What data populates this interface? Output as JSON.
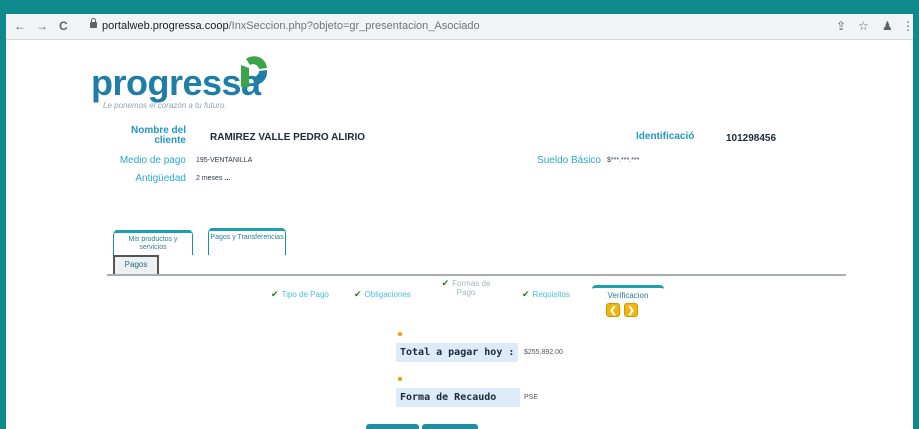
{
  "browser": {
    "url_host": "portalweb.progressa.coop",
    "url_path": "/InxSeccion.php?objeto=gr_presentacion_Asociado",
    "back_glyph": "←",
    "forward_glyph": "→",
    "reload_glyph": "C",
    "share_glyph": "⇪",
    "star_glyph": "☆",
    "profile_glyph": "♟",
    "menu_glyph": "⋮"
  },
  "brand": {
    "name": "progressa",
    "tagline": "Le ponemos el corazón a tu futuro.",
    "colors": {
      "primary": "#1f7ea8",
      "green": "#3aa647",
      "accent": "#1d9fb0"
    }
  },
  "client": {
    "name_label": "Nombre del cliente",
    "name_value": "RAMIREZ VALLE PEDRO ALIRIO",
    "id_label": "Identificació",
    "id_value": "101298456",
    "payment_label": "Medio de pago",
    "payment_value": "195-VENTANILLA",
    "salary_label": "Sueldo Básico",
    "salary_value": "$***.***.***",
    "age_label": "Antigüedad",
    "age_value": "2 meses",
    "age_more": "..."
  },
  "tabs": {
    "products": "Mis productos y servicios",
    "payments": "Pagos y Transferencias",
    "sub_payments": "Pagos"
  },
  "steps": {
    "tipo": "Tipo de Pago",
    "obligaciones": "Obligaciones",
    "formas": "Formas de Pago",
    "requisitos": "Requisitos",
    "verificacion": "Verificacion",
    "check_glyph": "✔",
    "prev_glyph": "❮",
    "next_glyph": "❯"
  },
  "summary": {
    "total_label": "Total a pagar hoy :",
    "total_value": "$255,892.00",
    "method_label": "Forma de Recaudo",
    "method_value": "PSE"
  }
}
